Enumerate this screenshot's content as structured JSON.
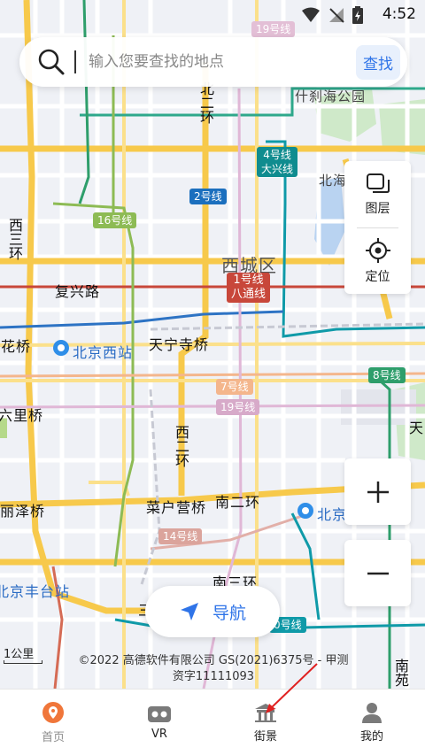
{
  "status_bar": {
    "time": "4:52"
  },
  "search": {
    "placeholder": "输入您要查找的地点",
    "button_label": "查找"
  },
  "side_controls": {
    "layers_label": "图层",
    "locate_label": "定位"
  },
  "zoom": {
    "in_symbol": "+",
    "out_symbol": "−"
  },
  "navigate_button": {
    "label": "导航"
  },
  "map": {
    "scale_label": "1公里",
    "copyright_line1": "©2022 高德软件有限公司 GS(2021)6375号 - 甲测",
    "copyright_line2": "资字11111093",
    "labels": {
      "shichahai": "什刹海公园",
      "beihai": "北海",
      "xichengqu": "西城区",
      "fuxinglu": "复兴路",
      "tianningsi": "天宁寺桥",
      "lianhuaqiao": "莲花桥",
      "beijingxizhan": "北京西站",
      "liuliqiao": "六里桥",
      "lizeqiao": "丽泽桥",
      "caihuying": "菜户营桥",
      "nanerhuan": "南二环",
      "beijingnan": "北京",
      "fengtaizhan": "北京丰台站",
      "nansanhuan": "南三环",
      "beierhuan": "北二环",
      "xierhuan_n": "西二环",
      "xisanhuan": "西三环",
      "xierhuan_s": "西二环",
      "tian": "天",
      "nanyuan": "南苑",
      "san": "三"
    },
    "lines": {
      "l19_top": "19号线",
      "l4": "4号线",
      "l4_sub": "大兴线",
      "l2": "2号线",
      "l16": "16号线",
      "l1": "1号线",
      "l1_sub": "八通线",
      "l7": "7号线",
      "l8": "8号线",
      "l19": "19号线",
      "l14": "14号线",
      "l10": "0号线"
    }
  },
  "bottom_nav": {
    "items": [
      {
        "label": "首页",
        "icon": "location-pin-icon"
      },
      {
        "label": "VR",
        "icon": "vr-headset-icon"
      },
      {
        "label": "街景",
        "icon": "street-view-icon"
      },
      {
        "label": "我的",
        "icon": "user-icon"
      }
    ]
  },
  "colors": {
    "accent": "#2f74e8",
    "home_active": "#f0763a",
    "line1": "#c23a30",
    "line2": "#0f6ab4",
    "line4": "#008c95",
    "line7": "#f5b183",
    "line8": "#2e9e6b",
    "line14": "#d5a7a1",
    "line16": "#76a32e",
    "line19": "#d4a7c7"
  }
}
